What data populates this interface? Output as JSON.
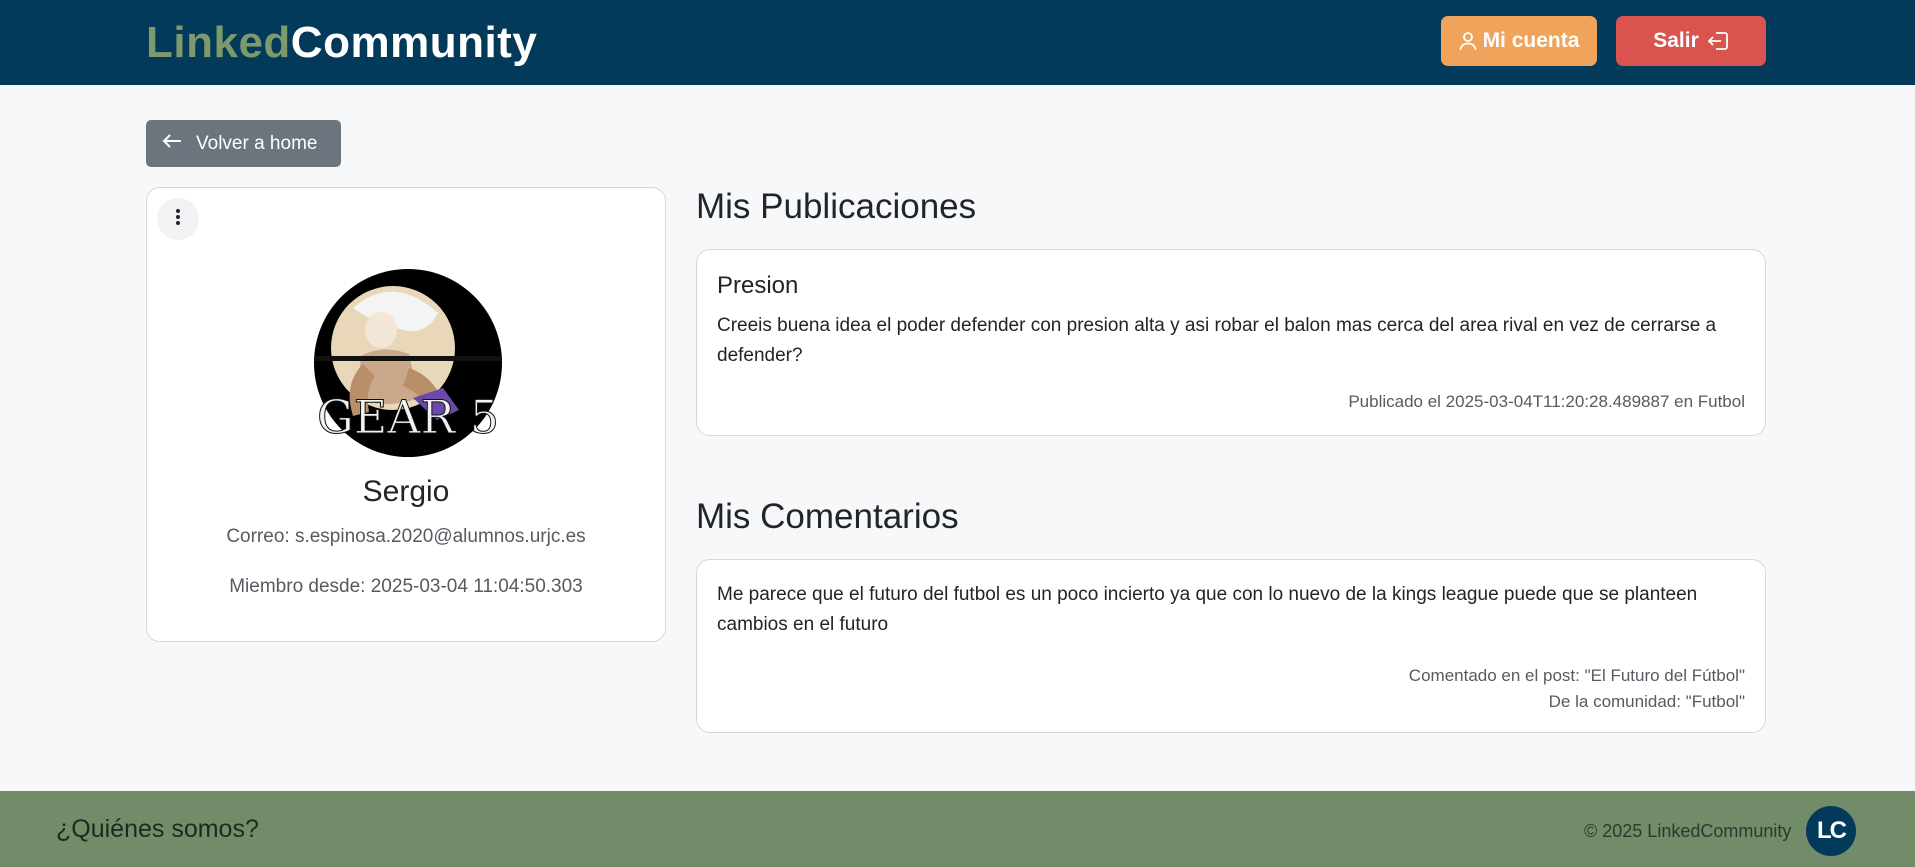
{
  "header": {
    "brand_part1": "Linked",
    "brand_part2": "Community",
    "account_label": "Mi cuenta",
    "account_icon": "user-icon",
    "logout_label": "Salir",
    "logout_icon": "logout-icon"
  },
  "back_button": {
    "label": "Volver a home",
    "icon": "arrow-left-icon"
  },
  "profile": {
    "menu_icon": "kebab-menu-icon",
    "avatar_text": "GEAR 5",
    "name": "Sergio",
    "email": "Correo: s.espinosa.2020@alumnos.urjc.es",
    "member_since": "Miembro desde: 2025-03-04 11:04:50.303"
  },
  "publications": {
    "title": "Mis Publicaciones",
    "items": [
      {
        "title": "Presion",
        "body": "Creeis buena idea el poder defender con presion alta y asi robar el balon mas cerca del area rival en vez de cerrarse a defender?",
        "meta": "Publicado el 2025-03-04T11:20:28.489887 en Futbol"
      }
    ]
  },
  "comments": {
    "title": "Mis Comentarios",
    "items": [
      {
        "body": "Me parece que el futuro del futbol es un poco incierto ya que con lo nuevo de la kings league puede que se planteen cambios en el futuro",
        "meta_post": "Comentado en el post: \"El Futuro del Fútbol\"",
        "meta_community": "De la comunidad: \"Futbol\""
      }
    ]
  },
  "footer": {
    "about_link": "¿Quiénes somos?",
    "copyright": "© 2025 LinkedCommunity",
    "logo_text": "LC"
  },
  "colors": {
    "header_bg": "#033a5a",
    "brand_accent": "#7c9a6b",
    "account_button": "#f0a35b",
    "logout_button": "#d9534f",
    "back_button": "#6c757d",
    "footer_bg": "#728b69"
  }
}
